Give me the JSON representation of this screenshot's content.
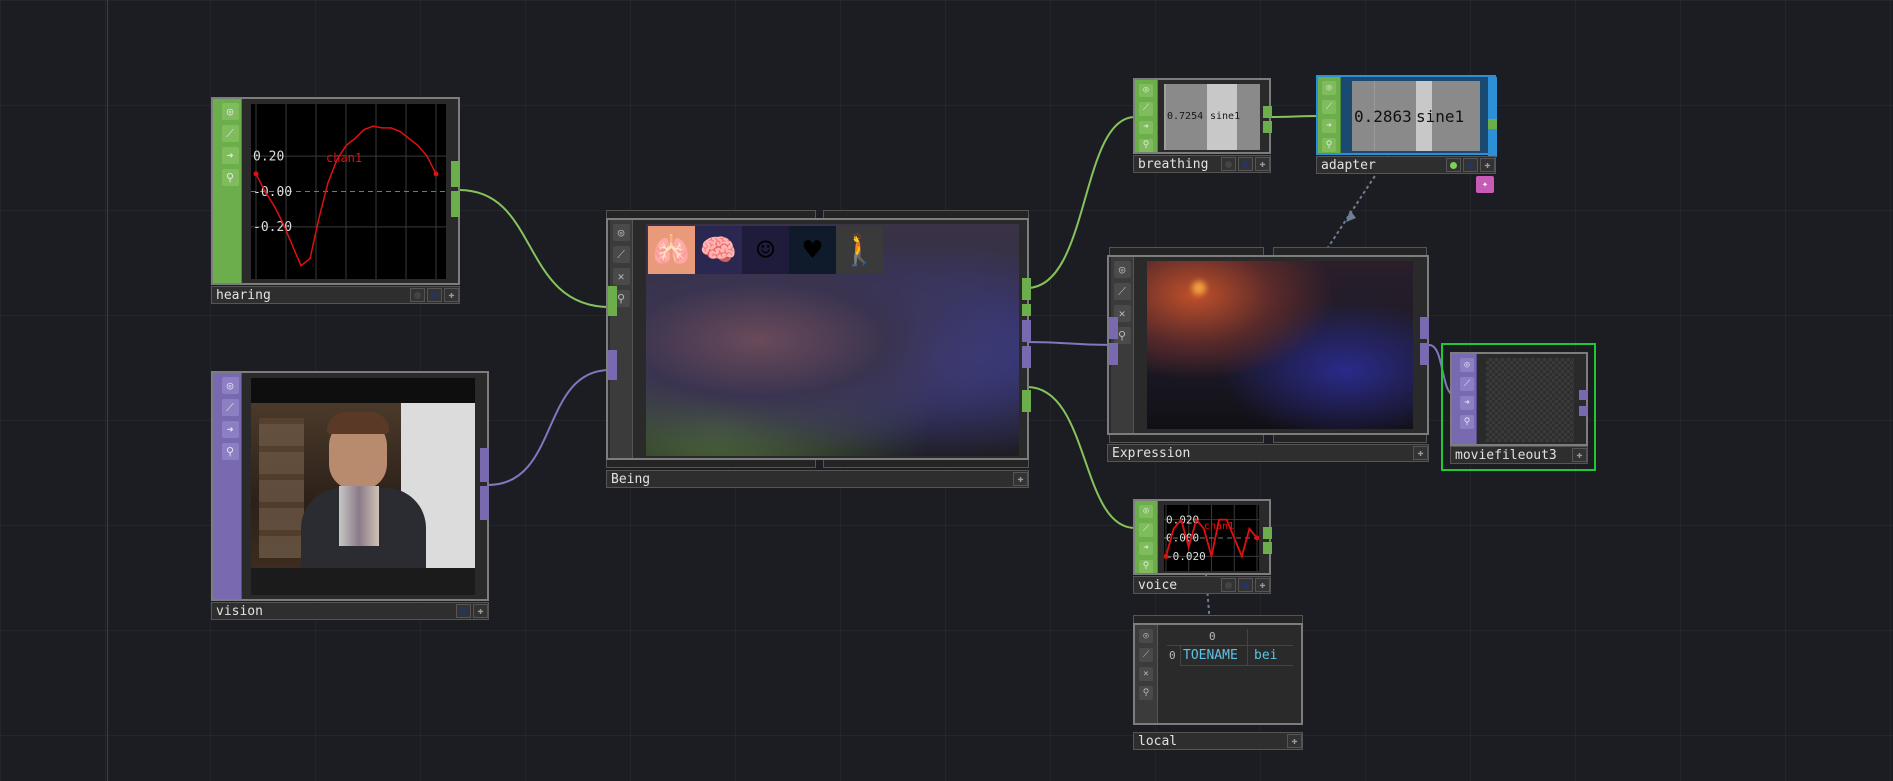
{
  "nodes": {
    "hearing": {
      "label": "hearing",
      "chart_data": {
        "type": "line",
        "series": [
          {
            "name": "chan1",
            "x": [
              0,
              5,
              10,
              15,
              20,
              25,
              30,
              35,
              40,
              45,
              50,
              55,
              60,
              65,
              70,
              75,
              80,
              85,
              90,
              95,
              100
            ],
            "values": [
              0.1,
              0.0,
              -0.08,
              -0.18,
              -0.3,
              -0.42,
              -0.38,
              -0.15,
              0.05,
              0.18,
              0.26,
              0.3,
              0.35,
              0.37,
              0.36,
              0.36,
              0.34,
              0.3,
              0.26,
              0.2,
              0.1
            ]
          }
        ],
        "yticks": [
          "0.20",
          "-0.00",
          "-0.20"
        ],
        "ylim": [
          -0.45,
          0.45
        ],
        "grid": true
      }
    },
    "vision": {
      "label": "vision"
    },
    "being": {
      "label": "Being",
      "icons": [
        "lungs-icon",
        "brain-icon",
        "smiley-icon",
        "heart-icon",
        "figure-icon"
      ]
    },
    "breathing": {
      "label": "breathing",
      "value": "0.7254",
      "channel": "sine1"
    },
    "adapter": {
      "label": "adapter",
      "value": "0.2863",
      "channel": "sine1"
    },
    "expression": {
      "label": "Expression"
    },
    "moviefileout": {
      "label": "moviefileout3"
    },
    "voice": {
      "label": "voice",
      "chart_data": {
        "type": "line",
        "series": [
          {
            "name": "chan1",
            "x": [
              0,
              1,
              2,
              3,
              4,
              5,
              6,
              7,
              8,
              9,
              10,
              11,
              12
            ],
            "values": [
              -0.02,
              0.01,
              0.02,
              -0.01,
              0.02,
              0.01,
              -0.02,
              0.02,
              0.02,
              0.0,
              -0.02,
              0.01,
              0.0
            ]
          }
        ],
        "yticks": [
          "0.020",
          "0.000",
          "-0.020"
        ],
        "ylim": [
          -0.025,
          0.025
        ],
        "grid": true
      }
    },
    "local": {
      "label": "local",
      "table": {
        "col_header": "0",
        "row_header": "0",
        "cells": [
          "TOENAME",
          "bei"
        ]
      }
    }
  },
  "colors": {
    "chop": "#6cad4c",
    "top": "#7869b0",
    "dat": "#3b3b3b",
    "selected": "#22c832",
    "signal": "#e01010"
  }
}
